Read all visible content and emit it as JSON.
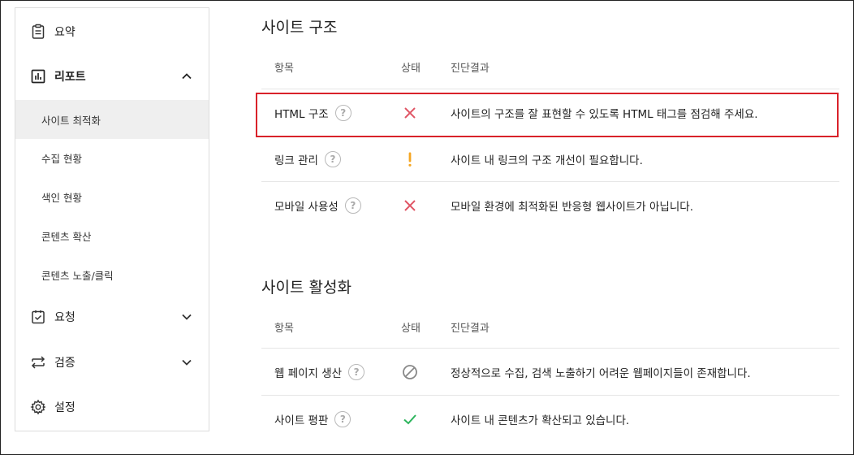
{
  "sidebar": {
    "summary": "요약",
    "report": "리포트",
    "report_sub": [
      "사이트 최적화",
      "수집 현황",
      "색인 현황",
      "콘텐츠 확산",
      "콘텐츠 노출/클릭"
    ],
    "request": "요청",
    "verify": "검증",
    "settings": "설정"
  },
  "sections": [
    {
      "title": "사이트 구조",
      "headers": {
        "item": "항목",
        "status": "상태",
        "result": "진단결과"
      },
      "rows": [
        {
          "name": "HTML 구조",
          "status": "error",
          "result": "사이트의 구조를 잘 표현할 수 있도록 HTML 태그를 점검해 주세요."
        },
        {
          "name": "링크 관리",
          "status": "warning",
          "result": "사이트 내 링크의 구조 개선이 필요합니다."
        },
        {
          "name": "모바일 사용성",
          "status": "error",
          "result": "모바일 환경에 최적화된 반응형 웹사이트가 아닙니다."
        }
      ]
    },
    {
      "title": "사이트 활성화",
      "headers": {
        "item": "항목",
        "status": "상태",
        "result": "진단결과"
      },
      "rows": [
        {
          "name": "웹 페이지 생산",
          "status": "blocked",
          "result": "정상적으로 수집, 검색 노출하기 어려운 웹페이지들이 존재합니다."
        },
        {
          "name": "사이트 평판",
          "status": "ok",
          "result": "사이트 내 콘텐츠가 확산되고 있습니다."
        }
      ]
    }
  ],
  "help_glyph": "?",
  "colors": {
    "error": "#e05565",
    "warning": "#f5a623",
    "ok": "#2db55d",
    "blocked": "#888888",
    "highlight": "#d9222a"
  }
}
